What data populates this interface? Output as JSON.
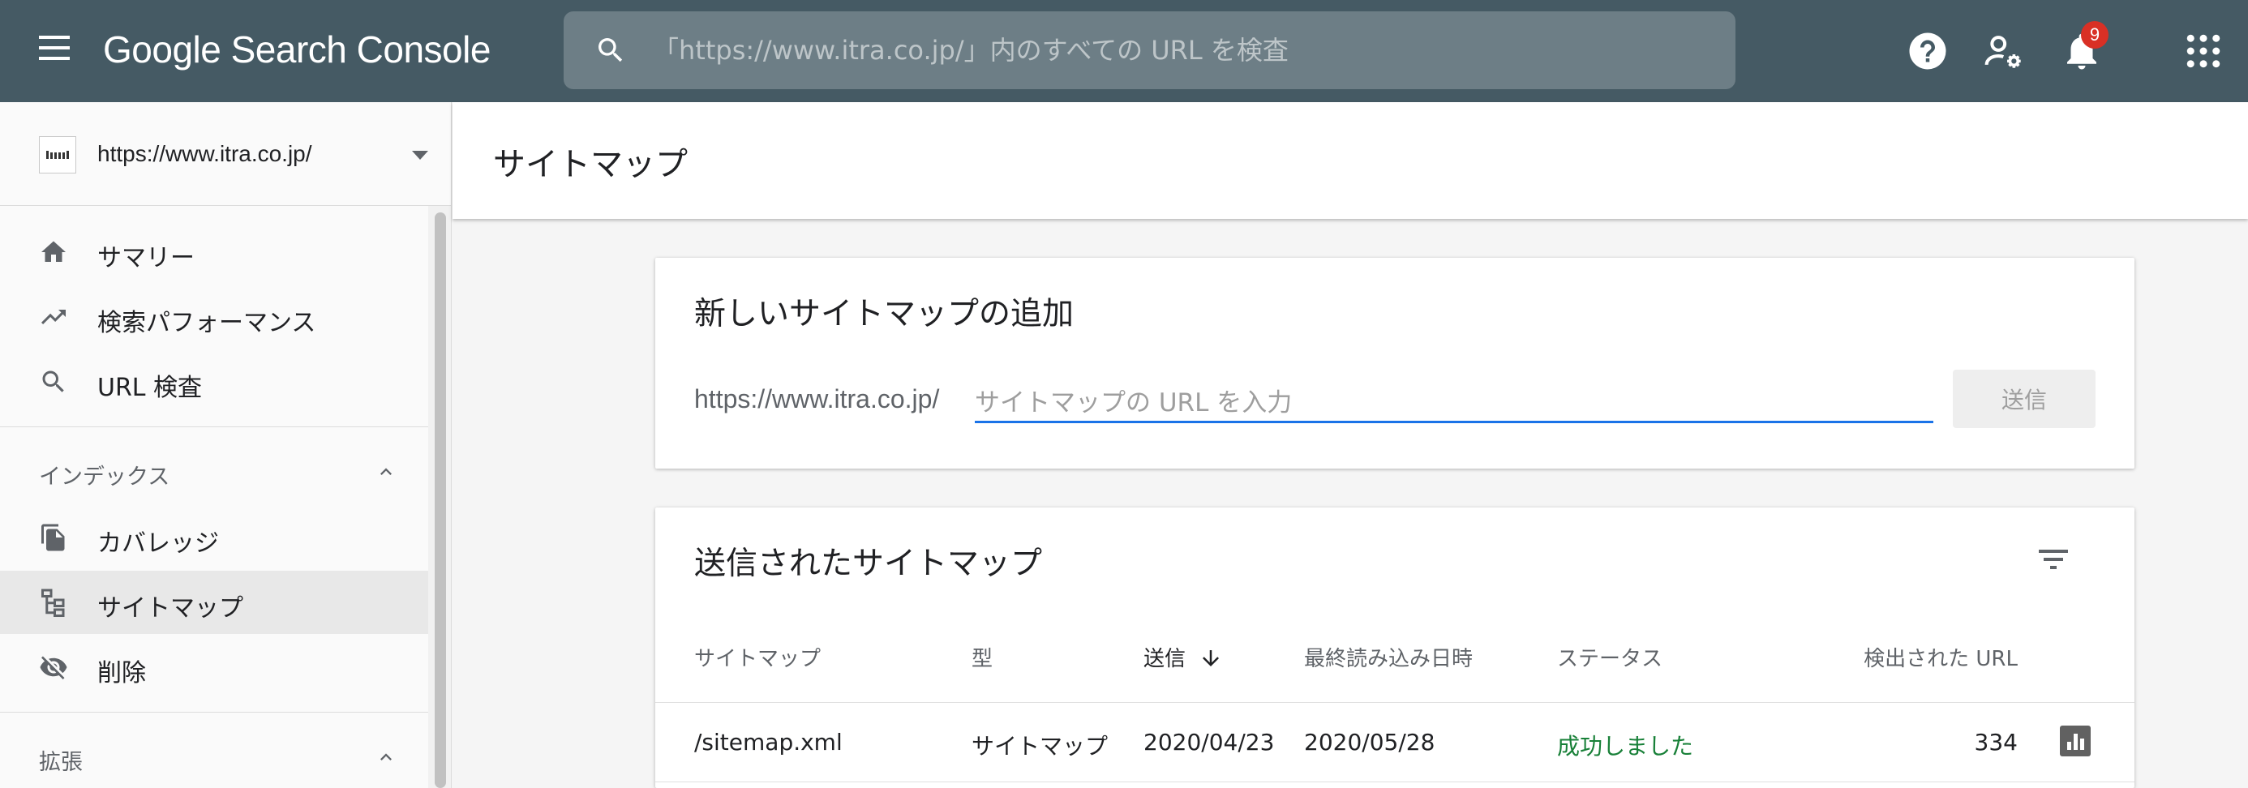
{
  "app": {
    "title": "Google Search Console",
    "search_placeholder": "「https://www.itra.co.jp/」内のすべての URL を検査",
    "notification_count": "9"
  },
  "sidebar": {
    "property_url": "https://www.itra.co.jp/",
    "items": [
      {
        "label": "サマリー",
        "icon": "home-icon"
      },
      {
        "label": "検索パフォーマンス",
        "icon": "trending-up-icon"
      },
      {
        "label": "URL 検査",
        "icon": "search-icon"
      }
    ],
    "sections": [
      {
        "label": "インデックス",
        "items": [
          {
            "label": "カバレッジ",
            "icon": "copy-icon"
          },
          {
            "label": "サイトマップ",
            "icon": "sitemap-icon",
            "active": true
          },
          {
            "label": "削除",
            "icon": "visibility-off-icon"
          }
        ]
      },
      {
        "label": "拡張"
      }
    ]
  },
  "main": {
    "page_title": "サイトマップ",
    "add_card": {
      "title": "新しいサイトマップの追加",
      "prefix": "https://www.itra.co.jp/",
      "input_placeholder": "サイトマップの URL を入力",
      "submit_label": "送信"
    },
    "submitted_card": {
      "title": "送信されたサイトマップ",
      "columns": {
        "sitemap": "サイトマップ",
        "type": "型",
        "submitted": "送信",
        "last_read": "最終読み込み日時",
        "status": "ステータス",
        "discovered": "検出された URL"
      },
      "rows": [
        {
          "sitemap": "/sitemap.xml",
          "type": "サイトマップ",
          "submitted": "2020/04/23",
          "last_read": "2020/05/28",
          "status": "成功しました",
          "discovered": "334"
        }
      ]
    }
  },
  "colors": {
    "topbar": "#455a64",
    "accent": "#1a73e8",
    "success": "#188038",
    "badge": "#d93025"
  }
}
